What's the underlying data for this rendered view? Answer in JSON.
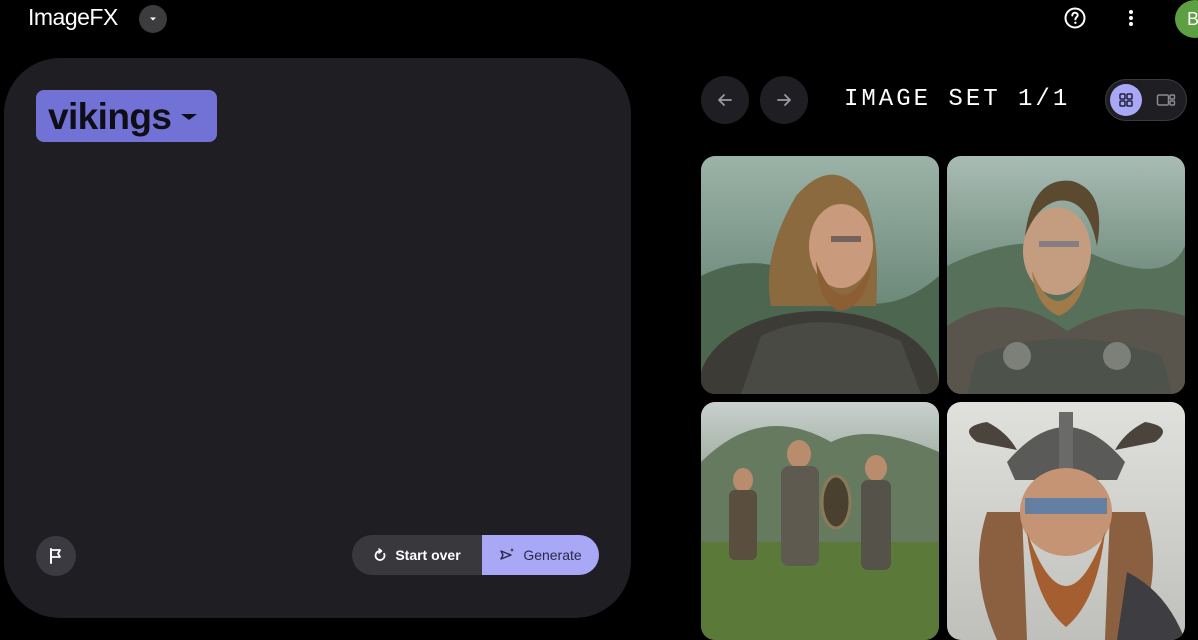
{
  "app": {
    "title": "ImageFX",
    "avatar_initial": "B",
    "accent_color": "#a8a8f7",
    "chip_color": "#7272d6"
  },
  "icons": {
    "app_menu": "chevron-down-icon",
    "help": "help-circle-icon",
    "more": "more-vert-icon",
    "flag": "flag-icon",
    "start_over": "refresh-icon",
    "generate": "sparkle-send-icon",
    "prev": "arrow-left-icon",
    "next": "arrow-right-icon",
    "grid_view": "grid-view-icon",
    "single_view": "single-view-icon"
  },
  "prompt": {
    "chip_text": "vikings"
  },
  "actions": {
    "start_over_label": "Start over",
    "generate_label": "Generate"
  },
  "gallery": {
    "image_set_label": "IMAGE SET 1/1",
    "current_set": 1,
    "total_sets": 1,
    "selected_view": "grid",
    "images": [
      {
        "name": "viking-portrait-1"
      },
      {
        "name": "viking-portrait-2"
      },
      {
        "name": "viking-group"
      },
      {
        "name": "viking-helmet-portrait"
      }
    ]
  }
}
